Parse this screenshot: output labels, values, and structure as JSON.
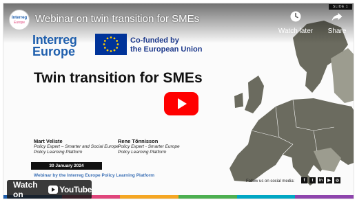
{
  "video": {
    "title": "Webinar on twin transition for SMEs",
    "slide_tag": "SLIDE 1",
    "channel_avatar": {
      "line1": "Interreg",
      "line2": "Europe"
    }
  },
  "top_actions": {
    "watch_later_label": "Watch later",
    "share_label": "Share"
  },
  "slide": {
    "program_logo": {
      "line1": "Interreg",
      "line2": "Europe"
    },
    "cofunded_line1": "Co-funded by",
    "cofunded_line2": "the European Union",
    "heading": "Twin transition for SMEs",
    "speakers": [
      {
        "name": "Mart Veliste",
        "role1": "Policy Expert – Smarter and Social Europe",
        "role2": "Policy Learning Platform"
      },
      {
        "name": "Rene Tõnnisson",
        "role1": "Policy Expert - Smarter Europe",
        "role2": "Policy Learning Platform"
      }
    ],
    "date": "30 January 2024",
    "webinar_by": "Webinar by the Interreg Europe Policy Learning Platform",
    "follow_text": "Follow us on social media:",
    "social_icons": [
      "f",
      "t",
      "in",
      "▶",
      "◎"
    ]
  },
  "watch_on": {
    "label": "Watch on",
    "brand": "YouTube"
  },
  "colors": {
    "interreg_blue": "#1f5fad",
    "eu_blue": "#003399",
    "eu_star": "#ffcc00",
    "play_red": "#ff0000",
    "map_land": "#6b6b5f",
    "map_land_light": "#9c9c8f",
    "strip": [
      "#1f5fad",
      "#e0457b",
      "#f5a623",
      "#4caf50",
      "#00a7c4",
      "#8e44ad"
    ]
  }
}
